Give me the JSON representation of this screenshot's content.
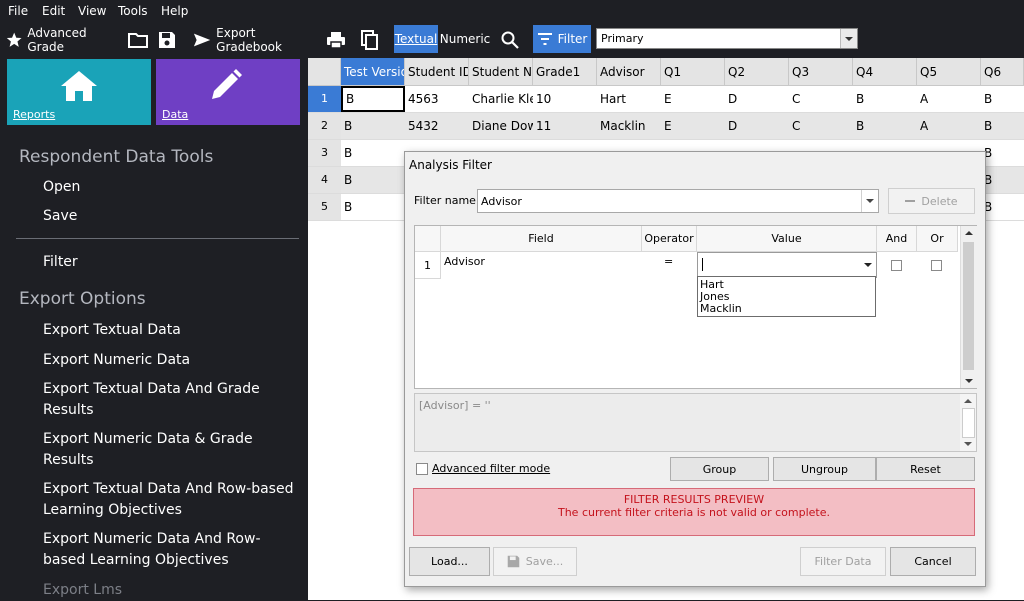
{
  "menu": [
    "File",
    "Edit",
    "View",
    "Tools",
    "Help"
  ],
  "toolbar": {
    "advanced_grade": "Advanced Grade",
    "export_gradebook": "Export Gradebook",
    "textual": "Textual",
    "numeric": "Numeric",
    "filter": "Filter",
    "dataset_select": "Primary",
    "accent": "#3a7bd5"
  },
  "tiles": [
    {
      "label": "Reports",
      "color": "#1aa3b8",
      "icon": "home-icon"
    },
    {
      "label": "Data",
      "color": "#6f3fc4",
      "icon": "pencil-icon"
    }
  ],
  "sidebar": {
    "section1": "Respondent Data Tools",
    "open": "Open",
    "save": "Save",
    "filter": "Filter",
    "section2": "Export Options",
    "export_items": [
      "Export Textual Data",
      "Export Numeric Data",
      "Export Textual Data And Grade Results",
      "Export Numeric Data & Grade Results",
      "Export Textual Data And Row-based Learning Objectives",
      "Export Numeric Data And Row-based Learning Objectives"
    ],
    "last_item": "Export Lms"
  },
  "grid": {
    "columns": [
      "Test Version",
      "Student ID",
      "Student Name",
      "Grade1",
      "Advisor",
      "Q1",
      "Q2",
      "Q3",
      "Q4",
      "Q5",
      "Q6"
    ],
    "rows": [
      {
        "n": "1",
        "cells": [
          "B",
          "4563",
          "Charlie Klein",
          "10",
          "Hart",
          "E",
          "D",
          "C",
          "B",
          "A",
          "B"
        ]
      },
      {
        "n": "2",
        "cells": [
          "B",
          "5432",
          "Diane Downs",
          "11",
          "Macklin",
          "E",
          "D",
          "C",
          "B",
          "A",
          "B"
        ]
      },
      {
        "n": "3",
        "cells": [
          "B",
          "",
          "",
          "",
          "",
          "",
          "",
          "",
          "",
          "",
          "B"
        ]
      },
      {
        "n": "4",
        "cells": [
          "B",
          "",
          "",
          "",
          "",
          "",
          "",
          "",
          "",
          "",
          "B"
        ]
      },
      {
        "n": "5",
        "cells": [
          "B",
          "",
          "",
          "",
          "",
          "",
          "",
          "",
          "",
          "",
          "B"
        ]
      }
    ]
  },
  "dialog": {
    "title": "Analysis Filter",
    "filter_name_label": "Filter name:",
    "filter_name_value": "Advisor",
    "delete": "Delete",
    "headers": {
      "field": "Field",
      "operator": "Operator",
      "value": "Value",
      "and": "And",
      "or": "Or"
    },
    "row": {
      "n": "1",
      "field": "Advisor",
      "operator": "=",
      "value": ""
    },
    "options": [
      "Hart",
      "Jones",
      "Macklin"
    ],
    "expression": "[Advisor] = ''",
    "advanced_mode": "Advanced filter mode",
    "group": "Group",
    "ungroup": "Ungroup",
    "reset": "Reset",
    "preview_title": "FILTER RESULTS PREVIEW",
    "preview_msg": "The current filter criteria is not valid or complete.",
    "load": "Load...",
    "save": "Save...",
    "filter_data": "Filter Data",
    "cancel": "Cancel"
  }
}
